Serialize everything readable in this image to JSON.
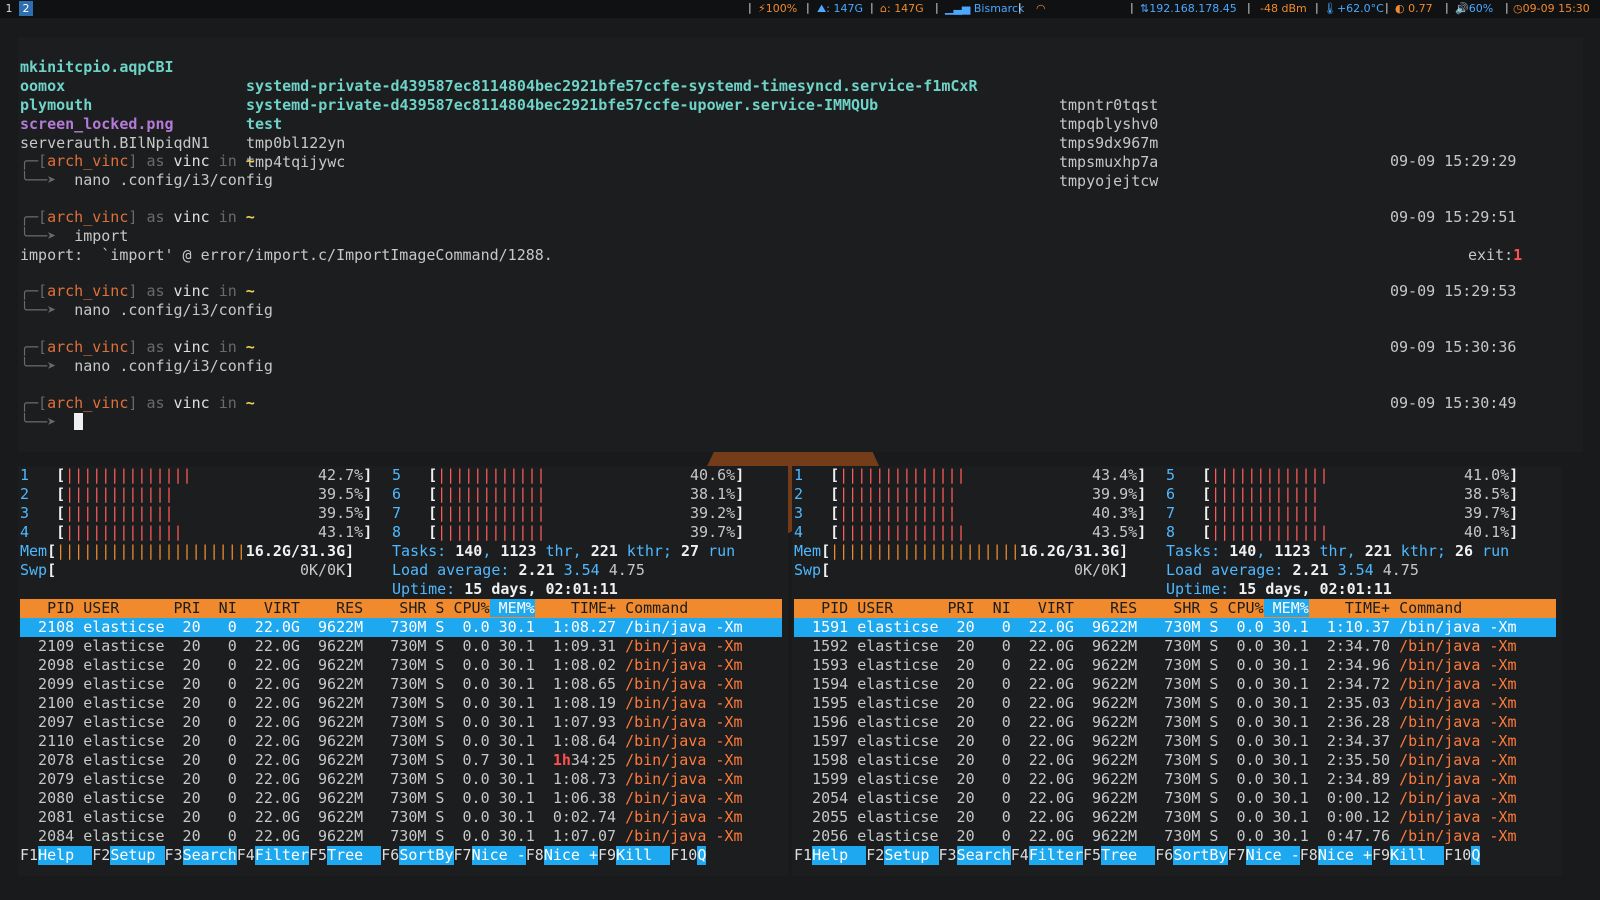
{
  "topbar": {
    "workspaces": [
      "1",
      "2"
    ],
    "battery": "100%",
    "disk1": "147G",
    "disk2": "147G",
    "wifi_name": "Bismarck",
    "ip": "192.168.178.45",
    "signal": "-48 dBm",
    "temp": "+62.0°C",
    "load": "0.77",
    "volume": "60%",
    "datetime": "09-09 15:30"
  },
  "terminal": {
    "ls": [
      [
        "mkinitcpio.aqpCBI",
        "systemd-private-d439587ec8114804bec2921bfe57ccfe-systemd-timesyncd.service-f1mCxR",
        "tmpntr0tqst"
      ],
      [
        "oomox",
        "systemd-private-d439587ec8114804bec2921bfe57ccfe-upower.service-IMMQUb",
        "tmpqblyshv0"
      ],
      [
        "plymouth",
        "test",
        "tmps9dx967m"
      ],
      [
        "screen_locked.png",
        "tmp0bl122yn",
        "tmpsmuxhp7a"
      ],
      [
        "serverauth.BIlNpiqdN1",
        "tmp4tqijywc",
        "tmpyojejtcw"
      ]
    ],
    "prompt": {
      "host": "arch_vinc",
      "as": "as",
      "user": "vinc",
      "in": "in",
      "dir": "~"
    },
    "entries": [
      {
        "time": "09-09 15:29:29",
        "cmd": "nano .config/i3/config"
      },
      {
        "time": "09-09 15:29:51",
        "cmd": "import",
        "output": "import:  `import' @ error/import.c/ImportImageCommand/1288.",
        "exit_label": "exit:",
        "exit_code": "1"
      },
      {
        "time": "09-09 15:29:53",
        "cmd": "nano .config/i3/config"
      },
      {
        "time": "09-09 15:30:36",
        "cmd": "nano .config/i3/config"
      },
      {
        "time": "09-09 15:30:49",
        "cmd": ""
      }
    ]
  },
  "htop_left": {
    "cpus": [
      {
        "n": "1",
        "bars": "||||||||||||||",
        "pct": "42.7%"
      },
      {
        "n": "2",
        "bars": "||||||||||||",
        "pct": "39.5%"
      },
      {
        "n": "3",
        "bars": "||||||||||||",
        "pct": "39.5%"
      },
      {
        "n": "4",
        "bars": "|||||||||||||",
        "pct": "43.1%"
      },
      {
        "n": "5",
        "bars": "||||||||||||",
        "pct": "40.6%"
      },
      {
        "n": "6",
        "bars": "||||||||||||",
        "pct": "38.1%"
      },
      {
        "n": "7",
        "bars": "||||||||||||",
        "pct": "39.2%"
      },
      {
        "n": "8",
        "bars": "||||||||||||",
        "pct": "39.7%"
      }
    ],
    "mem_label": "Mem",
    "mem": "16.2G/31.3G",
    "swp_label": "Swp",
    "swp": "0K/0K",
    "tasks": "140",
    "thr": "1123",
    "kthr": "221",
    "running": "27",
    "load": [
      "2.21",
      "3.54",
      "4.75"
    ],
    "uptime": "15 days, 02:01:11",
    "header": [
      "PID",
      "USER",
      "PRI",
      "NI",
      "VIRT",
      "RES",
      "SHR",
      "S",
      "CPU%",
      "MEM%",
      "TIME+",
      "Command"
    ],
    "rows": [
      [
        "2108",
        "elasticse",
        "20",
        "0",
        "22.0G",
        "9622M",
        "730M",
        "S",
        "0.0",
        "30.1",
        "1:08.27",
        "/bin/java -Xm"
      ],
      [
        "2109",
        "elasticse",
        "20",
        "0",
        "22.0G",
        "9622M",
        "730M",
        "S",
        "0.0",
        "30.1",
        "1:09.31",
        "/bin/java -Xm"
      ],
      [
        "2098",
        "elasticse",
        "20",
        "0",
        "22.0G",
        "9622M",
        "730M",
        "S",
        "0.0",
        "30.1",
        "1:08.02",
        "/bin/java -Xm"
      ],
      [
        "2099",
        "elasticse",
        "20",
        "0",
        "22.0G",
        "9622M",
        "730M",
        "S",
        "0.0",
        "30.1",
        "1:08.65",
        "/bin/java -Xm"
      ],
      [
        "2100",
        "elasticse",
        "20",
        "0",
        "22.0G",
        "9622M",
        "730M",
        "S",
        "0.0",
        "30.1",
        "1:08.19",
        "/bin/java -Xm"
      ],
      [
        "2097",
        "elasticse",
        "20",
        "0",
        "22.0G",
        "9622M",
        "730M",
        "S",
        "0.0",
        "30.1",
        "1:07.93",
        "/bin/java -Xm"
      ],
      [
        "2110",
        "elasticse",
        "20",
        "0",
        "22.0G",
        "9622M",
        "730M",
        "S",
        "0.0",
        "30.1",
        "1:08.64",
        "/bin/java -Xm"
      ],
      [
        "2078",
        "elasticse",
        "20",
        "0",
        "22.0G",
        "9622M",
        "730M",
        "S",
        "0.7",
        "30.1",
        "1h34:25",
        "/bin/java -Xm"
      ],
      [
        "2079",
        "elasticse",
        "20",
        "0",
        "22.0G",
        "9622M",
        "730M",
        "S",
        "0.0",
        "30.1",
        "1:08.73",
        "/bin/java -Xm"
      ],
      [
        "2080",
        "elasticse",
        "20",
        "0",
        "22.0G",
        "9622M",
        "730M",
        "S",
        "0.0",
        "30.1",
        "1:06.38",
        "/bin/java -Xm"
      ],
      [
        "2081",
        "elasticse",
        "20",
        "0",
        "22.0G",
        "9622M",
        "730M",
        "S",
        "0.0",
        "30.1",
        "0:02.74",
        "/bin/java -Xm"
      ],
      [
        "2084",
        "elasticse",
        "20",
        "0",
        "22.0G",
        "9622M",
        "730M",
        "S",
        "0.0",
        "30.1",
        "1:07.07",
        "/bin/java -Xm"
      ]
    ]
  },
  "htop_right": {
    "cpus": [
      {
        "n": "1",
        "bars": "||||||||||||||",
        "pct": "43.4%"
      },
      {
        "n": "2",
        "bars": "|||||||||||||",
        "pct": "39.9%"
      },
      {
        "n": "3",
        "bars": "|||||||||||||",
        "pct": "40.3%"
      },
      {
        "n": "4",
        "bars": "||||||||||||||",
        "pct": "43.5%"
      },
      {
        "n": "5",
        "bars": "|||||||||||||",
        "pct": "41.0%"
      },
      {
        "n": "6",
        "bars": "||||||||||||",
        "pct": "38.5%"
      },
      {
        "n": "7",
        "bars": "||||||||||||",
        "pct": "39.7%"
      },
      {
        "n": "8",
        "bars": "|||||||||||||",
        "pct": "40.1%"
      }
    ],
    "mem_label": "Mem",
    "mem": "16.2G/31.3G",
    "swp_label": "Swp",
    "swp": "0K/0K",
    "tasks": "140",
    "thr": "1123",
    "kthr": "221",
    "running": "26",
    "load": [
      "2.21",
      "3.54",
      "4.75"
    ],
    "uptime": "15 days, 02:01:11",
    "header": [
      "PID",
      "USER",
      "PRI",
      "NI",
      "VIRT",
      "RES",
      "SHR",
      "S",
      "CPU%",
      "MEM%",
      "TIME+",
      "Command"
    ],
    "rows": [
      [
        "1591",
        "elasticse",
        "20",
        "0",
        "22.0G",
        "9622M",
        "730M",
        "S",
        "0.0",
        "30.1",
        "1:10.37",
        "/bin/java -Xm"
      ],
      [
        "1592",
        "elasticse",
        "20",
        "0",
        "22.0G",
        "9622M",
        "730M",
        "S",
        "0.0",
        "30.1",
        "2:34.70",
        "/bin/java -Xm"
      ],
      [
        "1593",
        "elasticse",
        "20",
        "0",
        "22.0G",
        "9622M",
        "730M",
        "S",
        "0.0",
        "30.1",
        "2:34.96",
        "/bin/java -Xm"
      ],
      [
        "1594",
        "elasticse",
        "20",
        "0",
        "22.0G",
        "9622M",
        "730M",
        "S",
        "0.0",
        "30.1",
        "2:34.72",
        "/bin/java -Xm"
      ],
      [
        "1595",
        "elasticse",
        "20",
        "0",
        "22.0G",
        "9622M",
        "730M",
        "S",
        "0.0",
        "30.1",
        "2:35.03",
        "/bin/java -Xm"
      ],
      [
        "1596",
        "elasticse",
        "20",
        "0",
        "22.0G",
        "9622M",
        "730M",
        "S",
        "0.0",
        "30.1",
        "2:36.28",
        "/bin/java -Xm"
      ],
      [
        "1597",
        "elasticse",
        "20",
        "0",
        "22.0G",
        "9622M",
        "730M",
        "S",
        "0.0",
        "30.1",
        "2:34.37",
        "/bin/java -Xm"
      ],
      [
        "1598",
        "elasticse",
        "20",
        "0",
        "22.0G",
        "9622M",
        "730M",
        "S",
        "0.0",
        "30.1",
        "2:35.50",
        "/bin/java -Xm"
      ],
      [
        "1599",
        "elasticse",
        "20",
        "0",
        "22.0G",
        "9622M",
        "730M",
        "S",
        "0.0",
        "30.1",
        "2:34.89",
        "/bin/java -Xm"
      ],
      [
        "2054",
        "elasticse",
        "20",
        "0",
        "22.0G",
        "9622M",
        "730M",
        "S",
        "0.0",
        "30.1",
        "0:00.12",
        "/bin/java -Xm"
      ],
      [
        "2055",
        "elasticse",
        "20",
        "0",
        "22.0G",
        "9622M",
        "730M",
        "S",
        "0.0",
        "30.1",
        "0:00.12",
        "/bin/java -Xm"
      ],
      [
        "2056",
        "elasticse",
        "20",
        "0",
        "22.0G",
        "9622M",
        "730M",
        "S",
        "0.0",
        "30.1",
        "0:47.76",
        "/bin/java -Xm"
      ]
    ]
  },
  "fkeys": [
    {
      "key": "F1",
      "label": "Help  "
    },
    {
      "key": "F2",
      "label": "Setup "
    },
    {
      "key": "F3",
      "label": "Search"
    },
    {
      "key": "F4",
      "label": "Filter"
    },
    {
      "key": "F5",
      "label": "Tree  "
    },
    {
      "key": "F6",
      "label": "SortBy"
    },
    {
      "key": "F7",
      "label": "Nice -"
    },
    {
      "key": "F8",
      "label": "Nice +"
    },
    {
      "key": "F9",
      "label": "Kill  "
    },
    {
      "key": "F10",
      "label": "Q"
    }
  ]
}
